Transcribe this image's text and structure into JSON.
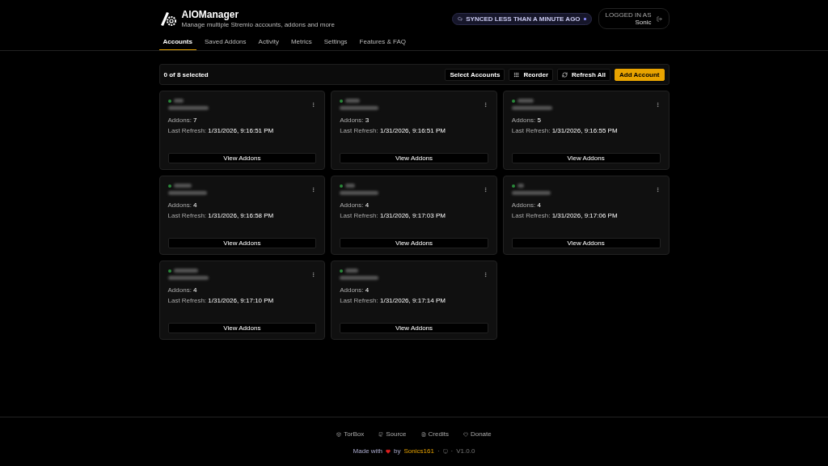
{
  "app": {
    "title": "AIOManager",
    "subtitle": "Manage multiple Stremio accounts, addons and more"
  },
  "tabs": [
    {
      "label": "Accounts",
      "selected": true
    },
    {
      "label": "Saved Addons",
      "selected": false
    },
    {
      "label": "Activity",
      "selected": false
    },
    {
      "label": "Metrics",
      "selected": false
    },
    {
      "label": "Settings",
      "selected": false
    },
    {
      "label": "Features & FAQ",
      "selected": false
    }
  ],
  "sync_status": "SYNCED LESS THAN A MINUTE AGO",
  "user": {
    "caption": "LOGGED IN AS",
    "name": "Sonic"
  },
  "toolbar": {
    "selection": "0 of 8 selected",
    "buttons": [
      {
        "kind": "plain",
        "label": "Select Accounts"
      },
      {
        "kind": "reorder",
        "label": "Reorder"
      },
      {
        "kind": "refresh",
        "label": "Refresh All"
      },
      {
        "kind": "primary",
        "label": "Add Account"
      }
    ]
  },
  "accounts": [
    {
      "addons_label": "Addons:",
      "addons": "7",
      "refresh_label": "Last Refresh:",
      "last_refresh": "1/31/2026, 9:16:51 PM",
      "button": "View Addons"
    },
    {
      "addons_label": "Addons:",
      "addons": "3",
      "refresh_label": "Last Refresh:",
      "last_refresh": "1/31/2026, 9:16:51 PM",
      "button": "View Addons"
    },
    {
      "addons_label": "Addons:",
      "addons": "5",
      "refresh_label": "Last Refresh:",
      "last_refresh": "1/31/2026, 9:16:55 PM",
      "button": "View Addons"
    },
    {
      "addons_label": "Addons:",
      "addons": "4",
      "refresh_label": "Last Refresh:",
      "last_refresh": "1/31/2026, 9:16:58 PM",
      "button": "View Addons"
    },
    {
      "addons_label": "Addons:",
      "addons": "4",
      "refresh_label": "Last Refresh:",
      "last_refresh": "1/31/2026, 9:17:03 PM",
      "button": "View Addons"
    },
    {
      "addons_label": "Addons:",
      "addons": "4",
      "refresh_label": "Last Refresh:",
      "last_refresh": "1/31/2026, 9:17:06 PM",
      "button": "View Addons"
    },
    {
      "addons_label": "Addons:",
      "addons": "4",
      "refresh_label": "Last Refresh:",
      "last_refresh": "1/31/2026, 9:17:10 PM",
      "button": "View Addons"
    },
    {
      "addons_label": "Addons:",
      "addons": "4",
      "refresh_label": "Last Refresh:",
      "last_refresh": "1/31/2026, 9:17:14 PM",
      "button": "View Addons"
    }
  ],
  "footer": {
    "links": [
      {
        "kind": "torbox",
        "label": "TorBox"
      },
      {
        "kind": "source",
        "label": "Source"
      },
      {
        "kind": "credits",
        "label": "Credits"
      },
      {
        "kind": "donate",
        "label": "Donate"
      }
    ],
    "made_with": "Made with",
    "by": "by",
    "author": "Sonics161",
    "separator_1": "·",
    "separator_2": "·",
    "version": "V1.0.0"
  }
}
